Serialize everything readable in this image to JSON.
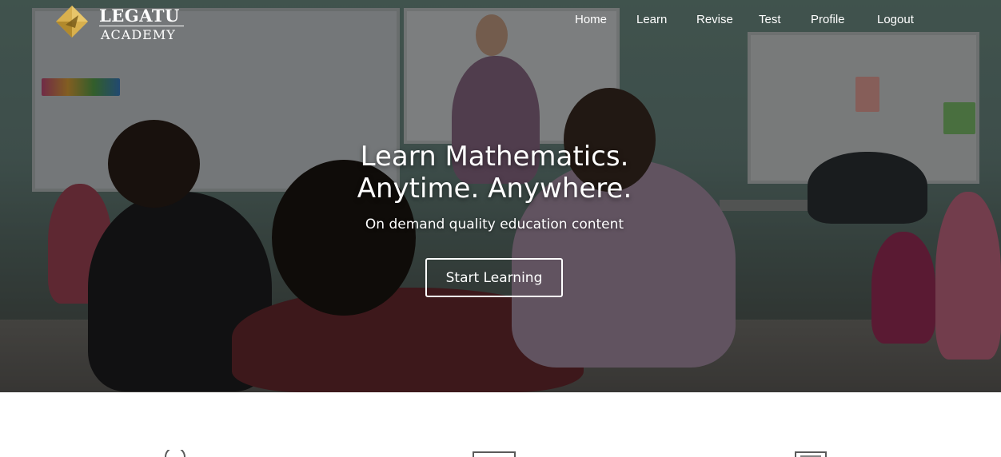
{
  "brand": {
    "name": "LEGATU",
    "sub": "ACADEMY",
    "colors": {
      "gold": "#d8b04e",
      "gold_dark": "#b28a2c"
    }
  },
  "nav": {
    "items": [
      {
        "label": "Home"
      },
      {
        "label": "Learn"
      },
      {
        "label": "Revise"
      },
      {
        "label": "Test"
      },
      {
        "label": "Profile"
      },
      {
        "label": "Logout"
      }
    ]
  },
  "hero": {
    "title_line1": "Learn Mathematics.",
    "title_line2": "Anytime. Anywhere.",
    "subtitle": "On demand quality education content",
    "cta_label": "Start Learning",
    "background": "classroom-photo"
  },
  "features": {
    "icons": [
      {
        "icon": "search-icon"
      },
      {
        "icon": "book-icon"
      },
      {
        "icon": "document-icon"
      }
    ]
  }
}
